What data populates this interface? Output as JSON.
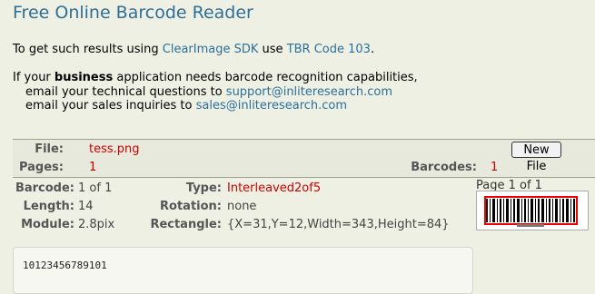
{
  "header": {
    "title": "Free Online Barcode Reader"
  },
  "intro": {
    "line1_prefix": "To get such results using ",
    "sdk_link": "ClearImage SDK",
    "line1_mid": " use ",
    "code_link": "TBR Code 103",
    "line1_suffix": ".",
    "line2_prefix": "If your ",
    "line2_bold": "business",
    "line2_suffix": " application needs barcode recognition capabilities,",
    "line3_prefix": "email your technical questions to ",
    "support_email": "support@inliteresearch.com",
    "line4_prefix": "email your sales inquiries to ",
    "sales_email": "sales@inliteresearch.com"
  },
  "file_info": {
    "file_label": "File:",
    "file_value": "tess.png",
    "pages_label": "Pages:",
    "pages_value": "1",
    "barcodes_label": "Barcodes:",
    "barcodes_value": "1",
    "new_file_button": "New File"
  },
  "barcode_info": {
    "barcode_label": "Barcode:",
    "barcode_value": "1 of 1",
    "length_label": "Length:",
    "length_value": "14",
    "module_label": "Module:",
    "module_value": "2.8pix",
    "type_label": "Type:",
    "type_value": "Interleaved2of5",
    "rotation_label": "Rotation:",
    "rotation_value": "none",
    "rectangle_label": "Rectangle:",
    "rectangle_value": "{X=31,Y=12,Width=343,Height=84}",
    "page_indicator": "Page 1 of 1"
  },
  "result": {
    "text": "10123456789101"
  },
  "colors": {
    "link": "#2c6f9a",
    "title": "#2f6e96",
    "highlight_red": "#cc0000",
    "background": "#eef0e3"
  }
}
